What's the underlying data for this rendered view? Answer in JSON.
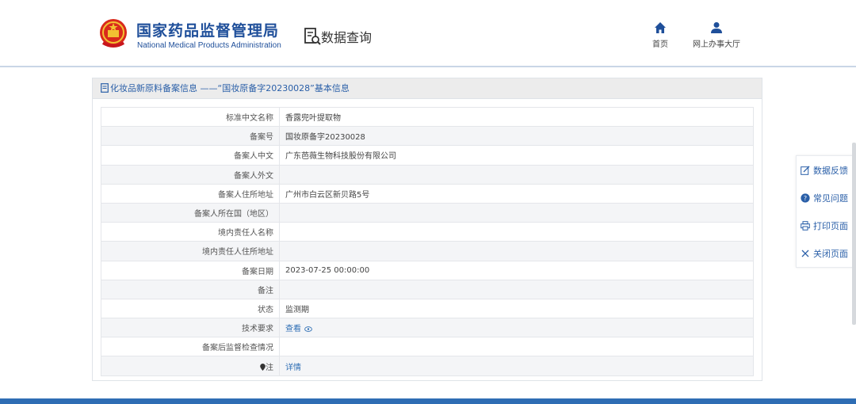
{
  "header": {
    "brand_cn": "国家药品监督管理局",
    "brand_en": "National Medical Products Administration",
    "query_label": "数据查询",
    "nav": {
      "home": "首页",
      "hall": "网上办事大厅"
    }
  },
  "panel": {
    "title": "化妆品新原料备案信息 ——“国妆原备字20230028”基本信息",
    "rows": [
      {
        "label": "标准中文名称",
        "value": "香露兜叶提取物"
      },
      {
        "label": "备案号",
        "value": "国妆原备字20230028"
      },
      {
        "label": "备案人中文",
        "value": "广东芭薇生物科技股份有限公司"
      },
      {
        "label": "备案人外文",
        "value": ""
      },
      {
        "label": "备案人住所地址",
        "value": "广州市白云区新贝路5号"
      },
      {
        "label": "备案人所在国（地区）",
        "value": ""
      },
      {
        "label": "境内责任人名称",
        "value": ""
      },
      {
        "label": "境内责任人住所地址",
        "value": ""
      },
      {
        "label": "备案日期",
        "value": "2023-07-25 00:00:00"
      },
      {
        "label": "备注",
        "value": ""
      },
      {
        "label": "状态",
        "value": "监测期"
      },
      {
        "label": "技术要求",
        "value": "查看"
      },
      {
        "label": "备案后监督检查情况",
        "value": ""
      },
      {
        "label": "注",
        "value": "详情"
      }
    ]
  },
  "side_tools": {
    "feedback": "数据反馈",
    "faq": "常见问题",
    "print": "打印页面",
    "close": "关闭页面"
  },
  "colors": {
    "brand_blue": "#1f4f9a",
    "link_blue": "#2f6fb5",
    "accent_red": "#c8161d",
    "accent_gold": "#f2c232"
  }
}
